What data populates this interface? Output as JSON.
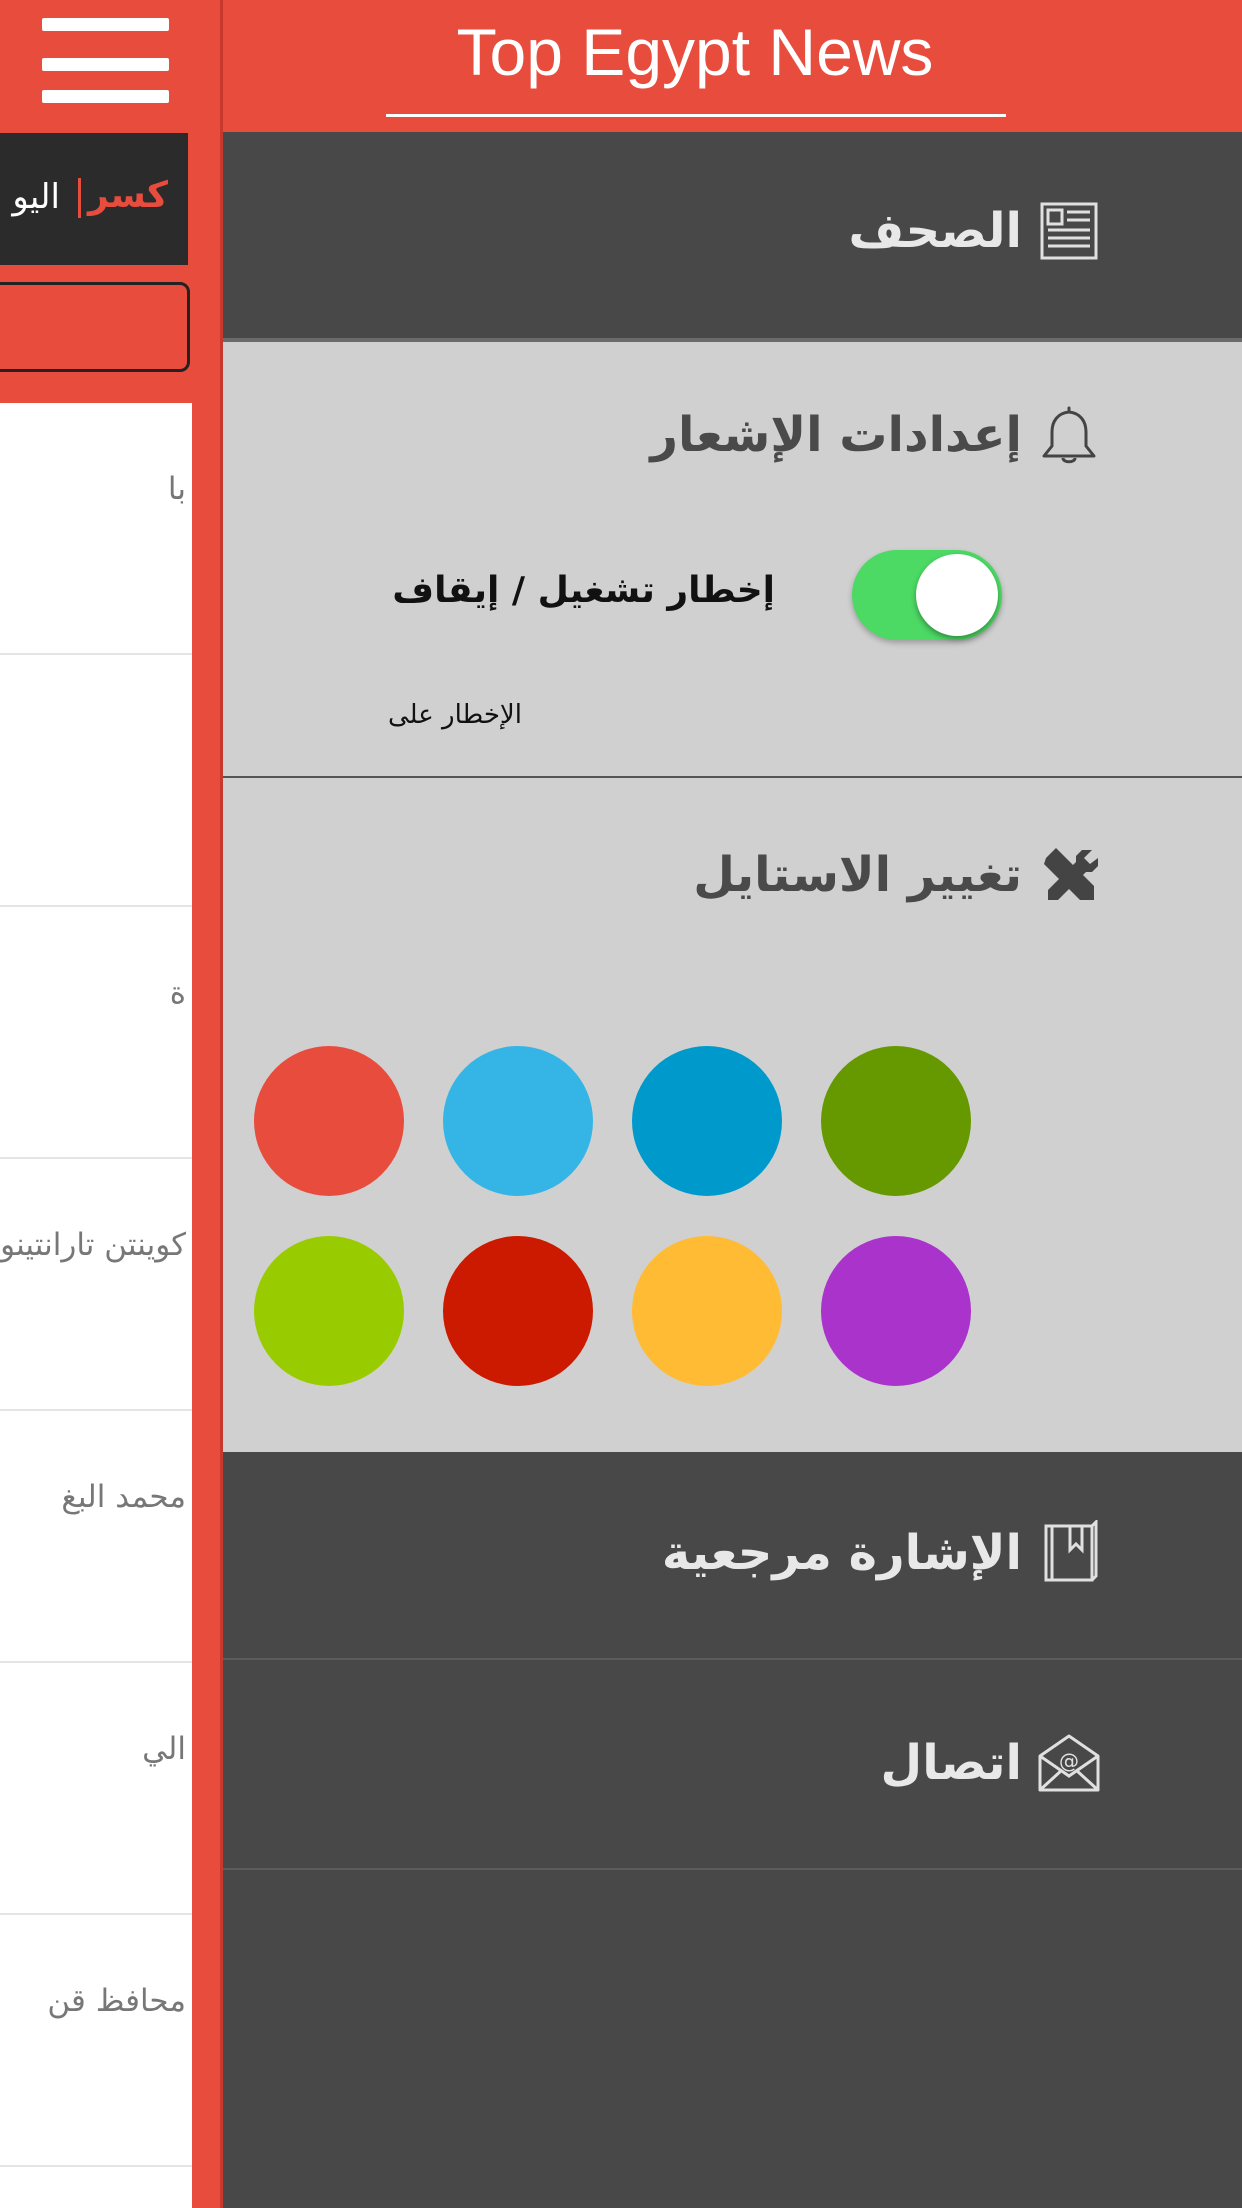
{
  "app": {
    "title": "Top Egypt News",
    "accent_color": "#e84c3d"
  },
  "main": {
    "menu_icon": "hamburger-icon",
    "ticker": {
      "label": "كسر",
      "text": "اليو"
    },
    "list_items": [
      "با",
      "",
      "ة",
      "كوينتن تارانتينو",
      "محمد البغ",
      "الي",
      "محافظ قن"
    ]
  },
  "drawer": {
    "papers": {
      "label": "الصحف",
      "icon": "newspaper-icon"
    },
    "notifications": {
      "label": "إعدادات الإشعار",
      "icon": "bell-icon",
      "toggle_label": "إخطار تشغيل / إيقاف",
      "toggle_on": true,
      "toggle_color": "#4cd964",
      "sub_label": "الإخطار على"
    },
    "style": {
      "label": "تغيير الاستايل",
      "icon": "tools-icon",
      "swatches": [
        "#e84c3d",
        "#35b5e5",
        "#0099cc",
        "#669900",
        "#99cc00",
        "#cc1a00",
        "#ffbb33",
        "#aa33cc"
      ]
    },
    "bookmark": {
      "label": "الإشارة مرجعية",
      "icon": "bookmark-book-icon"
    },
    "contact": {
      "label": "اتصال",
      "icon": "email-icon"
    }
  }
}
